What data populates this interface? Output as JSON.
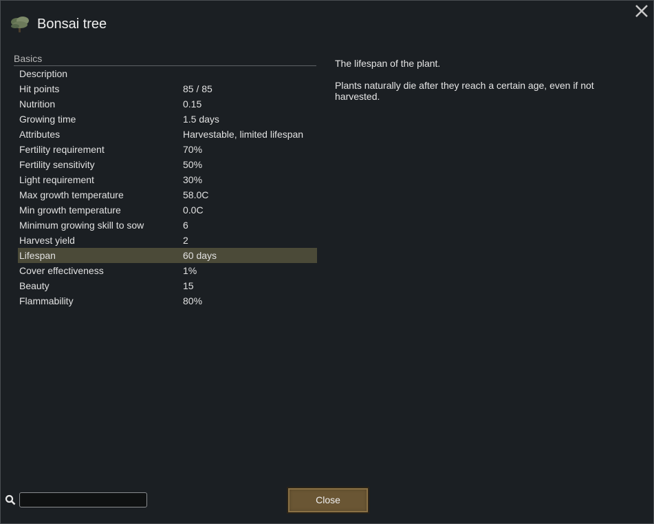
{
  "window": {
    "title": "Bonsai tree"
  },
  "section": {
    "header": "Basics"
  },
  "stats": [
    {
      "label": "Description",
      "value": ""
    },
    {
      "label": "Hit points",
      "value": "85 / 85"
    },
    {
      "label": "Nutrition",
      "value": "0.15"
    },
    {
      "label": "Growing time",
      "value": "1.5 days"
    },
    {
      "label": "Attributes",
      "value": "Harvestable, limited lifespan"
    },
    {
      "label": "Fertility requirement",
      "value": "70%"
    },
    {
      "label": "Fertility sensitivity",
      "value": "50%"
    },
    {
      "label": "Light requirement",
      "value": "30%"
    },
    {
      "label": "Max growth temperature",
      "value": "58.0C"
    },
    {
      "label": "Min growth temperature",
      "value": "0.0C"
    },
    {
      "label": "Minimum growing skill to sow",
      "value": "6"
    },
    {
      "label": "Harvest yield",
      "value": "2"
    },
    {
      "label": "Lifespan",
      "value": "60 days"
    },
    {
      "label": "Cover effectiveness",
      "value": "1%"
    },
    {
      "label": "Beauty",
      "value": "15"
    },
    {
      "label": "Flammability",
      "value": "80%"
    }
  ],
  "selected_stat": "Lifespan",
  "description": {
    "line1": "The lifespan of the plant.",
    "line2": "Plants naturally die after they reach a certain age, even if not harvested."
  },
  "search": {
    "value": "",
    "placeholder": ""
  },
  "buttons": {
    "close_label": "Close"
  },
  "icons": {
    "window_close": "close-icon",
    "plant": "bonsai-tree-icon",
    "search": "search-icon"
  },
  "colors": {
    "background": "#1b1f23",
    "selected_row": "#4b4a38",
    "button": "#6a5634"
  }
}
